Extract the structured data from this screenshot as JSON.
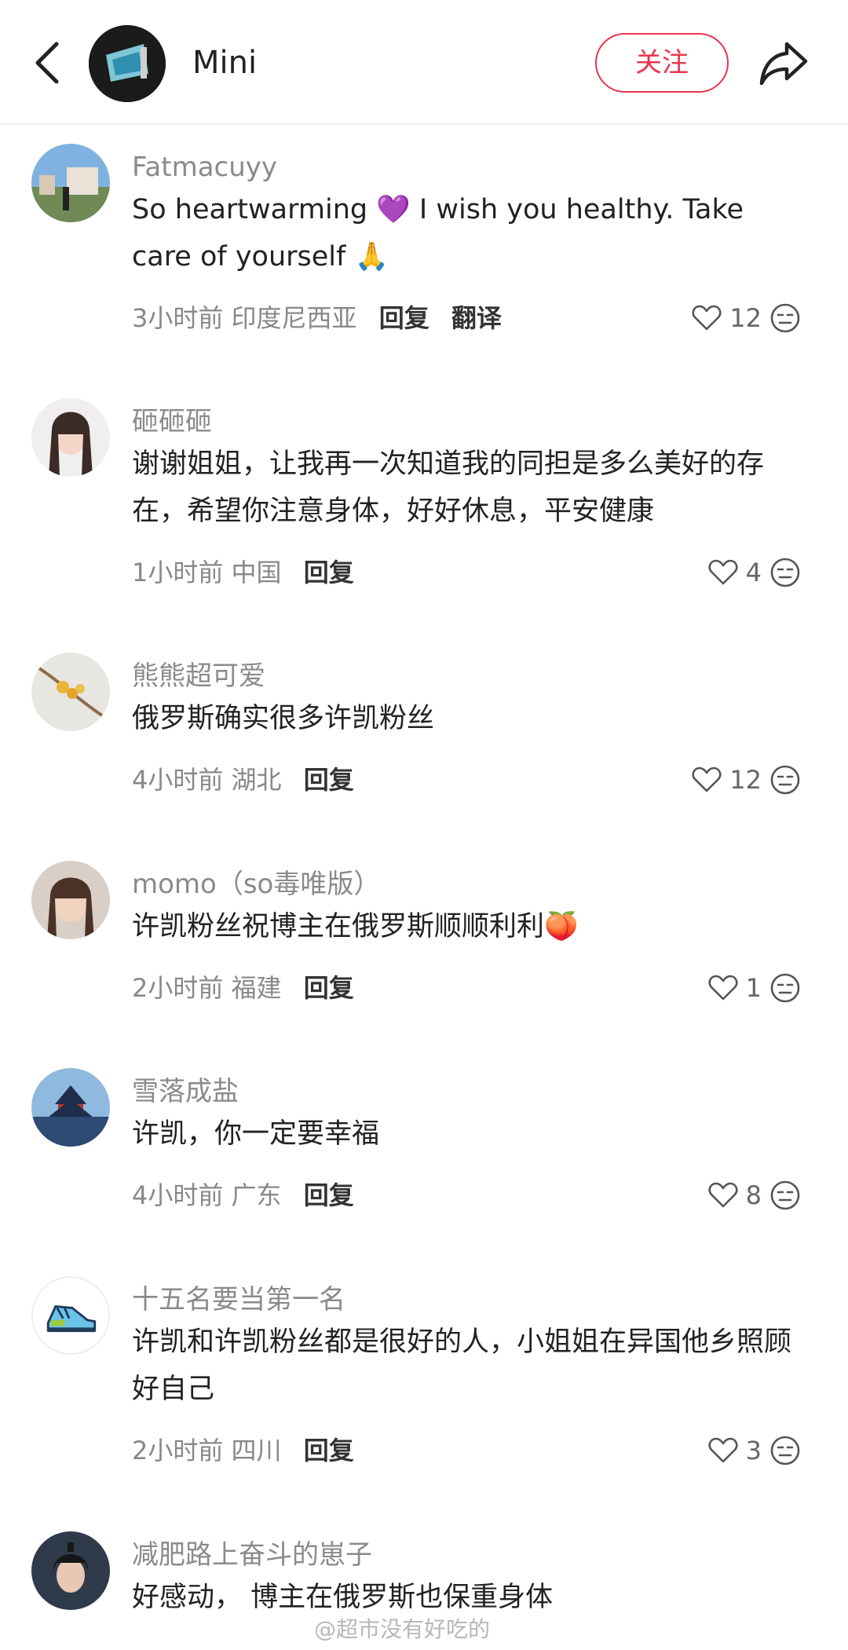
{
  "header": {
    "title": "Mini",
    "follow_label": "关注"
  },
  "comments": [
    {
      "user": "Fatmacuyy",
      "text": "So heartwarming 💜 I wish you healthy. Take care of yourself 🙏",
      "time": "3小时前",
      "location": "印度尼西亚",
      "reply": "回复",
      "translate": "翻译",
      "likes": "12"
    },
    {
      "user": "砸砸砸",
      "text": "谢谢姐姐，让我再一次知道我的同担是多么美好的存在，希望你注意身体，好好休息，平安健康",
      "time": "1小时前",
      "location": "中国",
      "reply": "回复",
      "likes": "4"
    },
    {
      "user": "熊熊超可爱",
      "text": "俄罗斯确实很多许凯粉丝",
      "time": "4小时前",
      "location": "湖北",
      "reply": "回复",
      "likes": "12"
    },
    {
      "user": "momo（so毒唯版）",
      "text": "许凯粉丝祝博主在俄罗斯顺顺利利🍑",
      "time": "2小时前",
      "location": "福建",
      "reply": "回复",
      "likes": "1"
    },
    {
      "user": "雪落成盐",
      "text": "许凯，你一定要幸福",
      "time": "4小时前",
      "location": "广东",
      "reply": "回复",
      "likes": "8"
    },
    {
      "user": "十五名要当第一名",
      "text": "许凯和许凯粉丝都是很好的人，小姐姐在异国他乡照顾好自己",
      "time": "2小时前",
      "location": "四川",
      "reply": "回复",
      "likes": "3"
    },
    {
      "user": "减肥路上奋斗的崽子",
      "text": "好感动， 博主在俄罗斯也保重身体"
    }
  ],
  "watermark": "@超市没有好吃的",
  "colors": {
    "accent": "#e8364f",
    "username": "#8a8a8a",
    "meta": "#888888"
  }
}
